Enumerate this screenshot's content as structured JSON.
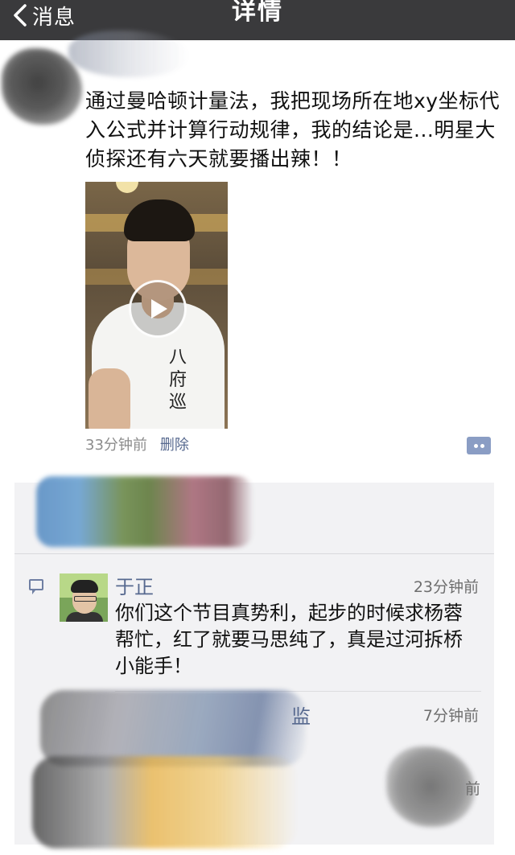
{
  "nav": {
    "back_label": "消息",
    "title": "详情"
  },
  "post": {
    "text": "通过曼哈顿计量法，我把现场所在地xy坐标代入公式并计算行动规律，我的结论是...明星大侦探还有六天就要播出辣！！",
    "video_shirt_text": "八府巡",
    "time": "33分钟前",
    "delete_label": "删除"
  },
  "comments": [
    {
      "name": "于正",
      "time": "23分钟前",
      "text": "你们这个节目真势利，起步的时候求杨蓉帮忙，红了就要马思纯了，真是过河拆桥小能手！"
    },
    {
      "name_visible_tail": "监",
      "time": "7分钟前"
    },
    {
      "time_visible_tail": "前"
    }
  ],
  "colors": {
    "navbar": "#3a3a3c",
    "link": "#57698f",
    "comment_bg": "#f2f2f4"
  }
}
